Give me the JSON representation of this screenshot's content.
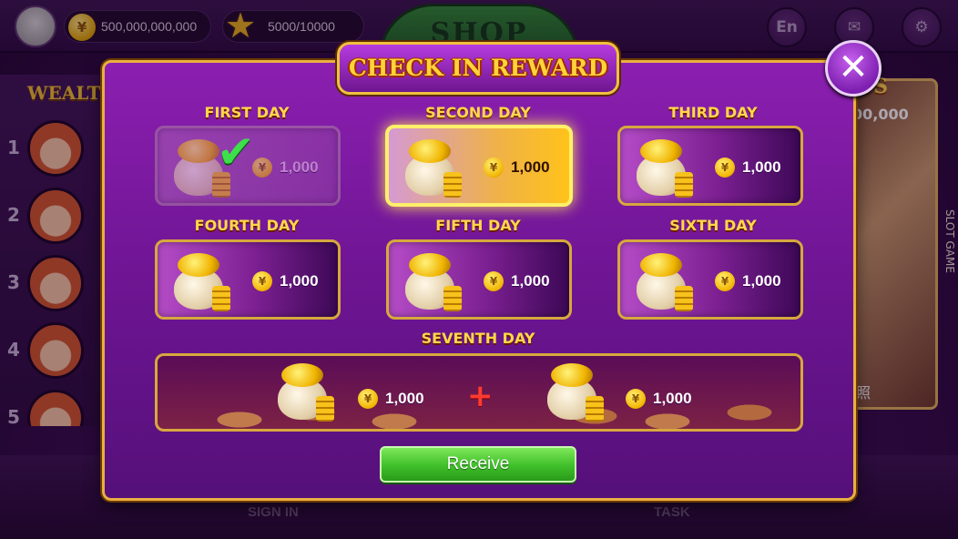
{
  "topbar": {
    "coins": "500,000,000,000",
    "coin_symbol": "¥",
    "stars": "5000/10000",
    "shop_label": "SHOP",
    "language": "En"
  },
  "background": {
    "leaderboard_title": "WEALT",
    "ranks": [
      "1",
      "2",
      "3",
      "4",
      "5"
    ],
    "bonus_title": "US",
    "bonus_amount": "00,000",
    "slot_label": "SLOT GAME",
    "side_text": "照",
    "bottom_tabs": {
      "sign_in": "SIGN IN",
      "task": "TASK"
    }
  },
  "dialog": {
    "title": "CHECK IN REWARD",
    "close_label": "✕",
    "coin_symbol": "¥",
    "days": [
      {
        "label": "FIRST DAY",
        "amount": "1,000",
        "state": "claimed"
      },
      {
        "label": "SECOND DAY",
        "amount": "1,000",
        "state": "today"
      },
      {
        "label": "THIRD DAY",
        "amount": "1,000",
        "state": "locked"
      },
      {
        "label": "FOURTH DAY",
        "amount": "1,000",
        "state": "locked"
      },
      {
        "label": "FIFTH DAY",
        "amount": "1,000",
        "state": "locked"
      },
      {
        "label": "SIXTH DAY",
        "amount": "1,000",
        "state": "locked"
      }
    ],
    "seventh": {
      "label": "SEVENTH DAY",
      "amount_1": "1,000",
      "plus": "+",
      "amount_2": "1,000"
    },
    "receive_label": "Receive"
  },
  "colors": {
    "accent_gold": "#ffd84a",
    "dialog_purple": "#6e1593",
    "receive_green": "#3fbf2a"
  }
}
